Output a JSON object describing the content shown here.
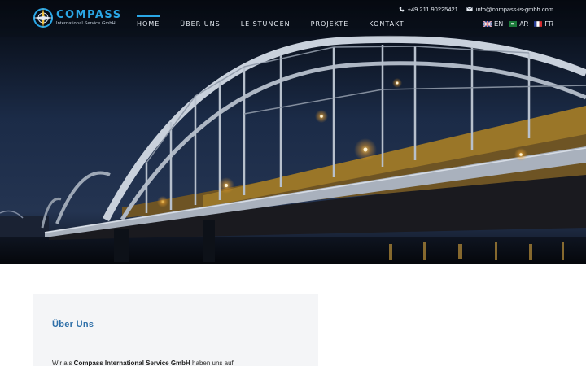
{
  "brand": {
    "name": "COMPASS",
    "subtitle": "International Service GmbH"
  },
  "nav": {
    "items": [
      {
        "label": "HOME",
        "active": true
      },
      {
        "label": "ÜBER UNS",
        "active": false
      },
      {
        "label": "LEISTUNGEN",
        "active": false
      },
      {
        "label": "PROJEKTE",
        "active": false
      },
      {
        "label": "KONTAKT",
        "active": false
      }
    ]
  },
  "contact": {
    "phone": "+49 211 90225421",
    "phone_icon": "phone-icon",
    "email": "info@compass-is-gmbh.com",
    "email_icon": "envelope-icon"
  },
  "languages": [
    {
      "code": "EN",
      "flag": "uk-flag"
    },
    {
      "code": "AR",
      "flag": "saudi-flag"
    },
    {
      "code": "FR",
      "flag": "france-flag"
    }
  ],
  "hero": {
    "image": "illuminated steel arch bridge at night over river"
  },
  "about": {
    "title": "Über Uns",
    "text_prefix": "Wir als ",
    "company": "Compass International Service GmbH",
    "text_suffix": " haben uns auf"
  },
  "colors": {
    "accent": "#2aa7e6",
    "title_blue": "#2e6fa8",
    "card_bg": "#f4f5f7"
  }
}
